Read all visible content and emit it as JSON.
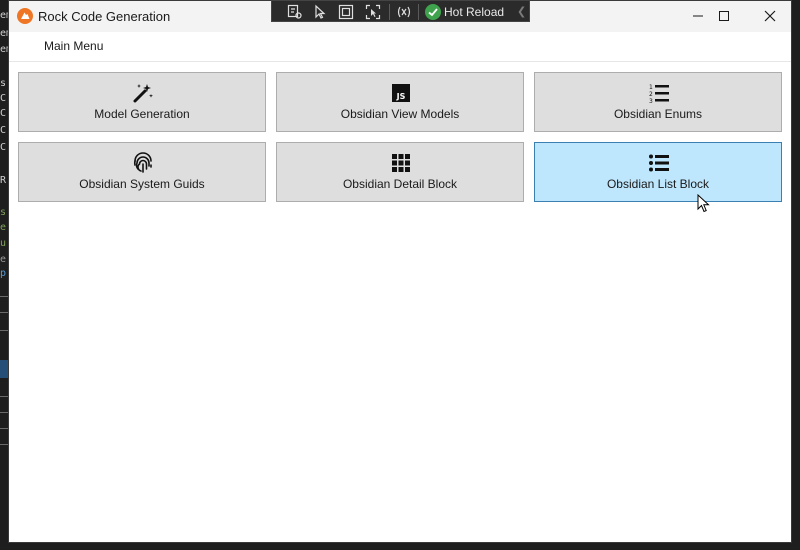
{
  "window": {
    "title": "Rock Code Generation"
  },
  "hot_reload_toolbar": {
    "label": "Hot Reload"
  },
  "menu": {
    "items": [
      {
        "label": "Main Menu"
      }
    ]
  },
  "tiles": [
    {
      "label": "Model Generation",
      "icon": "magic-wand-icon"
    },
    {
      "label": "Obsidian View Models",
      "icon": "javascript-icon"
    },
    {
      "label": "Obsidian Enums",
      "icon": "numbered-list-icon"
    },
    {
      "label": "Obsidian System Guids",
      "icon": "fingerprint-icon"
    },
    {
      "label": "Obsidian Detail Block",
      "icon": "grid-icon"
    },
    {
      "label": "Obsidian List Block",
      "icon": "bulleted-list-icon",
      "state": "hover"
    }
  ],
  "colors": {
    "tile_bg": "#dedede",
    "tile_hover_bg": "#bee6fd",
    "tile_hover_border": "#3c7fb1",
    "app_icon": "#ee7624",
    "hot_reload_check": "#3fa34d"
  }
}
